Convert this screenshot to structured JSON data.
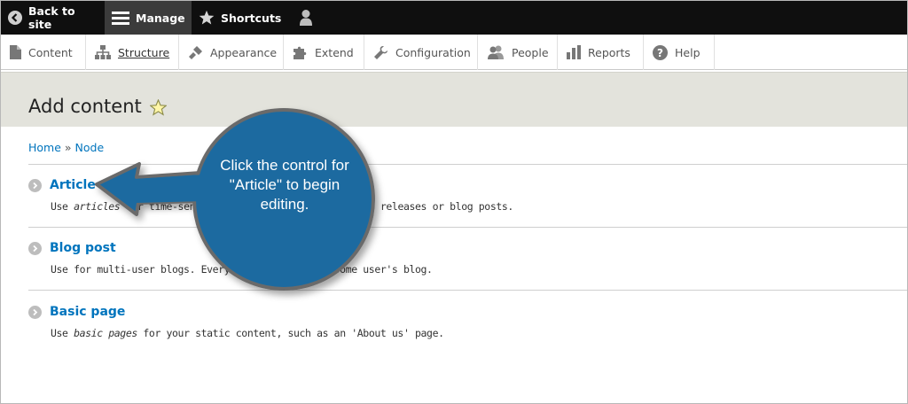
{
  "toolbar": {
    "back_label": "Back to site",
    "manage_label": "Manage",
    "shortcuts_label": "Shortcuts",
    "user_icon": "user-icon"
  },
  "tray": {
    "items": [
      {
        "label": "Content",
        "icon": "file-icon"
      },
      {
        "label": "Structure",
        "icon": "structure-icon"
      },
      {
        "label": "Appearance",
        "icon": "paintbrush-icon"
      },
      {
        "label": "Extend",
        "icon": "puzzle-icon"
      },
      {
        "label": "Configuration",
        "icon": "wrench-icon"
      },
      {
        "label": "People",
        "icon": "people-icon"
      },
      {
        "label": "Reports",
        "icon": "bar-chart-icon"
      },
      {
        "label": "Help",
        "icon": "help-icon"
      }
    ],
    "active": "Structure"
  },
  "page": {
    "title": "Add content",
    "breadcrumb": {
      "home": "Home",
      "sep": "»",
      "current": "Node"
    }
  },
  "content_types": [
    {
      "title": "Article",
      "desc_pre": "Use ",
      "desc_em": "articles",
      "desc_post": " for time-sensitive content like news, press releases or blog posts."
    },
    {
      "title": "Blog post",
      "desc_pre": "Use for multi-user blogs. Every entry is part of some user's blog.",
      "desc_em": "",
      "desc_post": ""
    },
    {
      "title": "Basic page",
      "desc_pre": "Use ",
      "desc_em": "basic pages",
      "desc_post": " for your static content, such as an 'About us' page."
    }
  ],
  "callout": {
    "text": "Click the control for \"Article\" to begin editing."
  },
  "colors": {
    "toolbar_bg": "#0f0f0f",
    "link": "#0074bd",
    "header_bg": "#e3e3dc",
    "callout_fill": "#1b6aa0",
    "callout_stroke": "#6a6a6a"
  }
}
